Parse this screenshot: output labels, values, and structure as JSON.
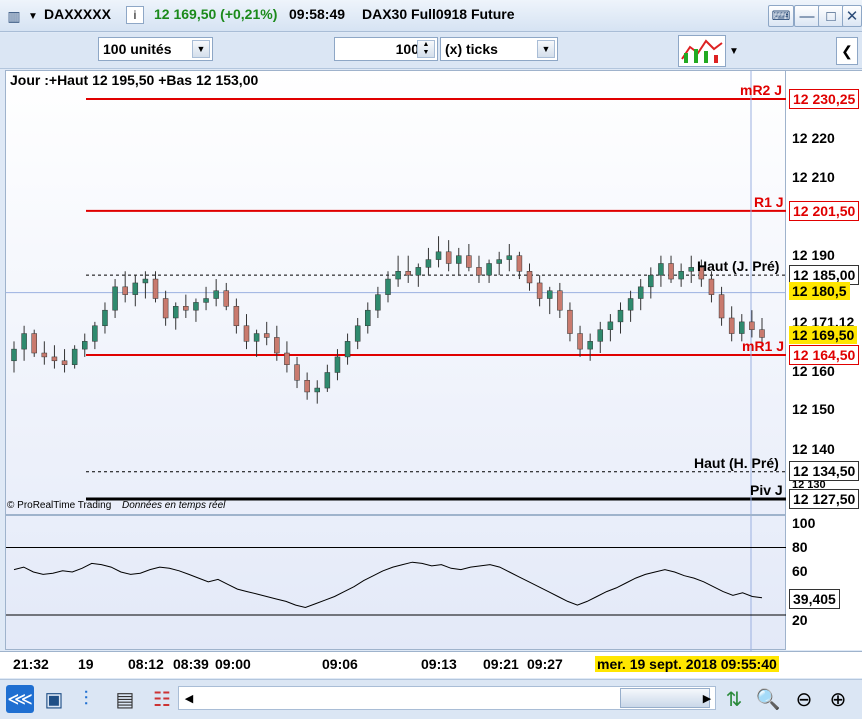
{
  "titlebar": {
    "ticker": "DAXXXXX",
    "price_change": "12 169,50 (+0,21%)",
    "time": "09:58:49",
    "instrument": "DAX30 Full0918 Future",
    "minimize": "—",
    "maximize": "□",
    "close": "✕"
  },
  "toolbar": {
    "units_value": "100 unités",
    "ticks_value": "100",
    "ticks_unit": "(x) ticks"
  },
  "chart": {
    "header": "Jour :+Haut 12 195,50 +Bas 12 153,00",
    "copyright": "© ProRealTime Trading",
    "realtime": "Données en temps réel",
    "levels": [
      {
        "name": "mR2 J",
        "price": 12230.25,
        "label": "12 230,25"
      },
      {
        "name": "R1 J",
        "price": 12201.5,
        "label": "12 201,50"
      },
      {
        "name": "Haut (J. Pré)",
        "price": 12185.0,
        "label": "12 185,00"
      },
      {
        "name": "mR1 J",
        "price": 12164.5,
        "label": "12 164,50"
      },
      {
        "name": "Haut (H. Pré)",
        "price": 12134.5,
        "label": "12 134,50"
      },
      {
        "name": "Piv J",
        "price": 12127.5,
        "label": "12 127,50"
      }
    ],
    "crosshair_price": "12 180,5",
    "last_price": "12 169,50",
    "partial_label": "12 171,12",
    "yticks": [
      "12 220",
      "12 210",
      "12 190",
      "12 160",
      "12 150",
      "12 140",
      "12 130"
    ],
    "osc_ticks": [
      "100",
      "80",
      "60",
      "20"
    ],
    "osc_value": "39,405",
    "time_labels": [
      "21:32",
      "19",
      "08:12",
      "08:39",
      "09:00",
      "09:06",
      "09:13",
      "09:21",
      "09:27"
    ],
    "cursor_date": "mer. 19 sept. 2018 09:55:40",
    "colors": {
      "up": "#2f8a6e",
      "down": "#c97a6e",
      "level": "#e00000",
      "highlight": "#ffe600"
    }
  },
  "chart_data": {
    "type": "candlestick",
    "candles": [
      [
        12163,
        12168,
        12160,
        12166
      ],
      [
        12166,
        12172,
        12163,
        12170
      ],
      [
        12170,
        12171,
        12164,
        12165
      ],
      [
        12165,
        12168,
        12162,
        12164
      ],
      [
        12164,
        12167,
        12161,
        12163
      ],
      [
        12163,
        12166,
        12160,
        12162
      ],
      [
        12162,
        12167,
        12161,
        12166
      ],
      [
        12166,
        12170,
        12164,
        12168
      ],
      [
        12168,
        12173,
        12166,
        12172
      ],
      [
        12172,
        12178,
        12170,
        12176
      ],
      [
        12176,
        12184,
        12174,
        12182
      ],
      [
        12182,
        12186,
        12178,
        12180
      ],
      [
        12180,
        12185,
        12177,
        12183
      ],
      [
        12183,
        12186,
        12179,
        12184
      ],
      [
        12184,
        12186,
        12178,
        12179
      ],
      [
        12179,
        12181,
        12172,
        12174
      ],
      [
        12174,
        12178,
        12171,
        12177
      ],
      [
        12177,
        12180,
        12174,
        12176
      ],
      [
        12176,
        12179,
        12173,
        12178
      ],
      [
        12178,
        12182,
        12176,
        12179
      ],
      [
        12179,
        12184,
        12177,
        12181
      ],
      [
        12181,
        12183,
        12176,
        12177
      ],
      [
        12177,
        12179,
        12170,
        12172
      ],
      [
        12172,
        12175,
        12166,
        12168
      ],
      [
        12168,
        12171,
        12164,
        12170
      ],
      [
        12170,
        12173,
        12167,
        12169
      ],
      [
        12169,
        12172,
        12163,
        12165
      ],
      [
        12165,
        12168,
        12160,
        12162
      ],
      [
        12162,
        12164,
        12156,
        12158
      ],
      [
        12158,
        12160,
        12153,
        12155
      ],
      [
        12155,
        12158,
        12152,
        12156
      ],
      [
        12156,
        12162,
        12155,
        12160
      ],
      [
        12160,
        12166,
        12158,
        12164
      ],
      [
        12164,
        12170,
        12162,
        12168
      ],
      [
        12168,
        12174,
        12166,
        12172
      ],
      [
        12172,
        12178,
        12170,
        12176
      ],
      [
        12176,
        12182,
        12174,
        12180
      ],
      [
        12180,
        12186,
        12178,
        12184
      ],
      [
        12184,
        12190,
        12182,
        12186
      ],
      [
        12186,
        12190,
        12183,
        12185
      ],
      [
        12185,
        12188,
        12182,
        12187
      ],
      [
        12187,
        12192,
        12185,
        12189
      ],
      [
        12189,
        12195,
        12187,
        12191
      ],
      [
        12191,
        12194,
        12186,
        12188
      ],
      [
        12188,
        12192,
        12185,
        12190
      ],
      [
        12190,
        12193,
        12186,
        12187
      ],
      [
        12187,
        12190,
        12183,
        12185
      ],
      [
        12185,
        12189,
        12183,
        12188
      ],
      [
        12188,
        12191,
        12185,
        12189
      ],
      [
        12189,
        12193,
        12186,
        12190
      ],
      [
        12190,
        12191,
        12184,
        12186
      ],
      [
        12186,
        12188,
        12181,
        12183
      ],
      [
        12183,
        12185,
        12177,
        12179
      ],
      [
        12179,
        12182,
        12175,
        12181
      ],
      [
        12181,
        12183,
        12174,
        12176
      ],
      [
        12176,
        12178,
        12168,
        12170
      ],
      [
        12170,
        12172,
        12164,
        12166
      ],
      [
        12166,
        12170,
        12163,
        12168
      ],
      [
        12168,
        12173,
        12165,
        12171
      ],
      [
        12171,
        12175,
        12168,
        12173
      ],
      [
        12173,
        12178,
        12170,
        12176
      ],
      [
        12176,
        12181,
        12173,
        12179
      ],
      [
        12179,
        12184,
        12176,
        12182
      ],
      [
        12182,
        12187,
        12179,
        12185
      ],
      [
        12185,
        12190,
        12182,
        12188
      ],
      [
        12188,
        12190,
        12183,
        12184
      ],
      [
        12184,
        12188,
        12182,
        12186
      ],
      [
        12186,
        12190,
        12183,
        12187
      ],
      [
        12187,
        12189,
        12182,
        12184
      ],
      [
        12184,
        12186,
        12178,
        12180
      ],
      [
        12180,
        12182,
        12172,
        12174
      ],
      [
        12174,
        12177,
        12168,
        12170
      ],
      [
        12170,
        12175,
        12168,
        12173
      ],
      [
        12173,
        12176,
        12169,
        12171
      ],
      [
        12171,
        12174,
        12167,
        12169
      ]
    ],
    "oscillator": [
      62,
      64,
      60,
      58,
      59,
      61,
      60,
      63,
      67,
      66,
      64,
      60,
      58,
      59,
      62,
      64,
      63,
      61,
      58,
      55,
      52,
      54,
      50,
      46,
      44,
      42,
      40,
      38,
      36,
      33,
      31,
      34,
      37,
      40,
      44,
      48,
      53,
      57,
      61,
      64,
      66,
      68,
      67,
      65,
      66,
      63,
      62,
      64,
      65,
      66,
      64,
      60,
      56,
      52,
      48,
      44,
      40,
      36,
      33,
      36,
      40,
      44,
      47,
      51,
      55,
      58,
      60,
      62,
      60,
      57,
      55,
      52,
      48,
      44,
      41,
      43,
      40,
      39
    ]
  },
  "bottombar": {
    "icons": [
      "share-icon",
      "layout-icon",
      "indicator-icon",
      "drawing-icon",
      "list-icon",
      "scroll-left-icon",
      "scroll-right-icon",
      "auto-scale-icon",
      "zoom-area-icon",
      "zoom-out-icon",
      "zoom-in-icon"
    ]
  }
}
